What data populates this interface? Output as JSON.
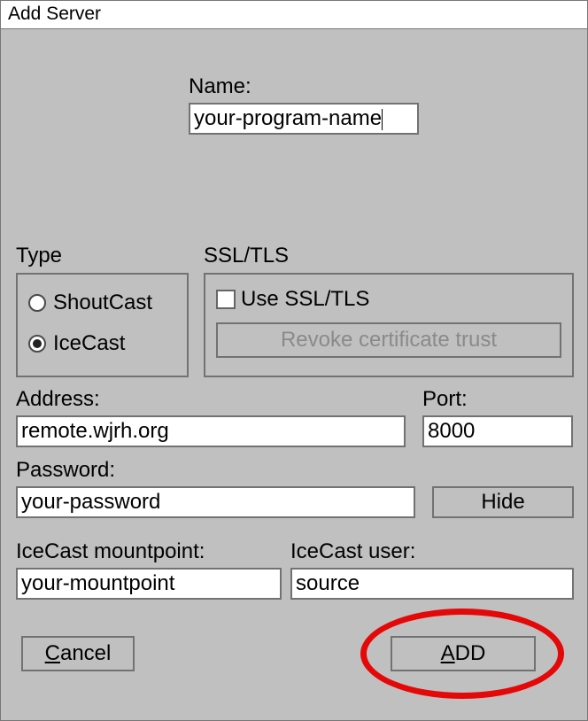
{
  "window": {
    "title": "Add Server"
  },
  "name": {
    "label": "Name:",
    "value": "your-program-name"
  },
  "type": {
    "label": "Type",
    "options": [
      {
        "label": "ShoutCast",
        "selected": false
      },
      {
        "label": "IceCast",
        "selected": true
      }
    ]
  },
  "ssl": {
    "label": "SSL/TLS",
    "checkbox_label": "Use SSL/TLS",
    "checkbox_checked": false,
    "revoke_label": "Revoke certificate trust"
  },
  "address": {
    "label": "Address:",
    "value": "remote.wjrh.org"
  },
  "port": {
    "label": "Port:",
    "value": "8000"
  },
  "password": {
    "label": "Password:",
    "value": "your-password",
    "hide_label": "Hide"
  },
  "mount": {
    "label": "IceCast mountpoint:",
    "value": "your-mountpoint"
  },
  "user": {
    "label": "IceCast user:",
    "value": "source"
  },
  "buttons": {
    "cancel": {
      "prefix": "",
      "mn": "C",
      "suffix": "ancel"
    },
    "add": {
      "prefix": "",
      "mn": "A",
      "suffix": "DD"
    }
  }
}
